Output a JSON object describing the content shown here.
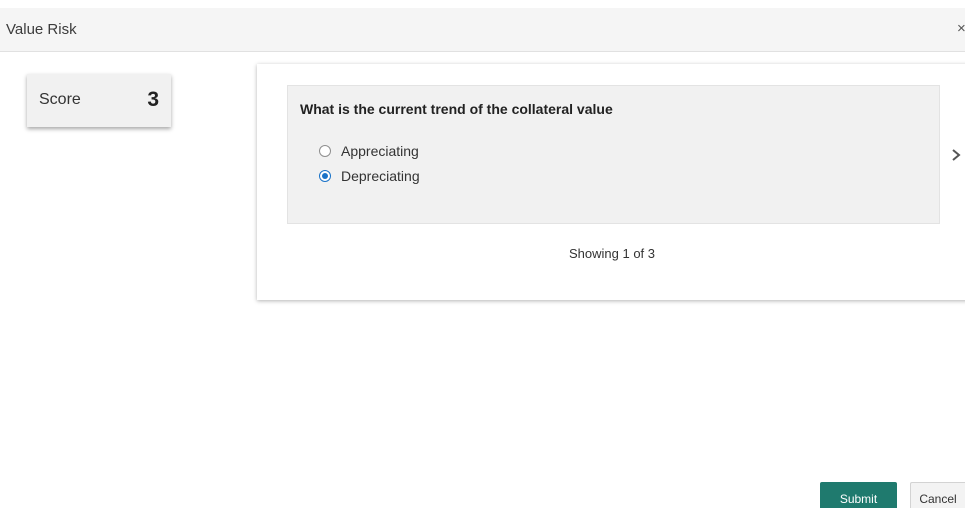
{
  "dialog": {
    "title": "Value Risk",
    "close_icon": "close-icon",
    "close_glyph": "×"
  },
  "score": {
    "label": "Score",
    "value": "3"
  },
  "question": {
    "text": "What is the current trend of the collateral value",
    "options": [
      {
        "label": "Appreciating",
        "selected": false
      },
      {
        "label": "Depreciating",
        "selected": true
      }
    ],
    "next_icon": "chevron-right-icon",
    "paging": "Showing 1 of 3"
  },
  "footer": {
    "submit_label": "Submit",
    "cancel_label": "Cancel"
  },
  "colors": {
    "primary_button": "#1f7a6e",
    "radio_selected": "#1a73c8",
    "header_bg": "#f5f5f5",
    "card_bg": "#f1f1f1"
  }
}
